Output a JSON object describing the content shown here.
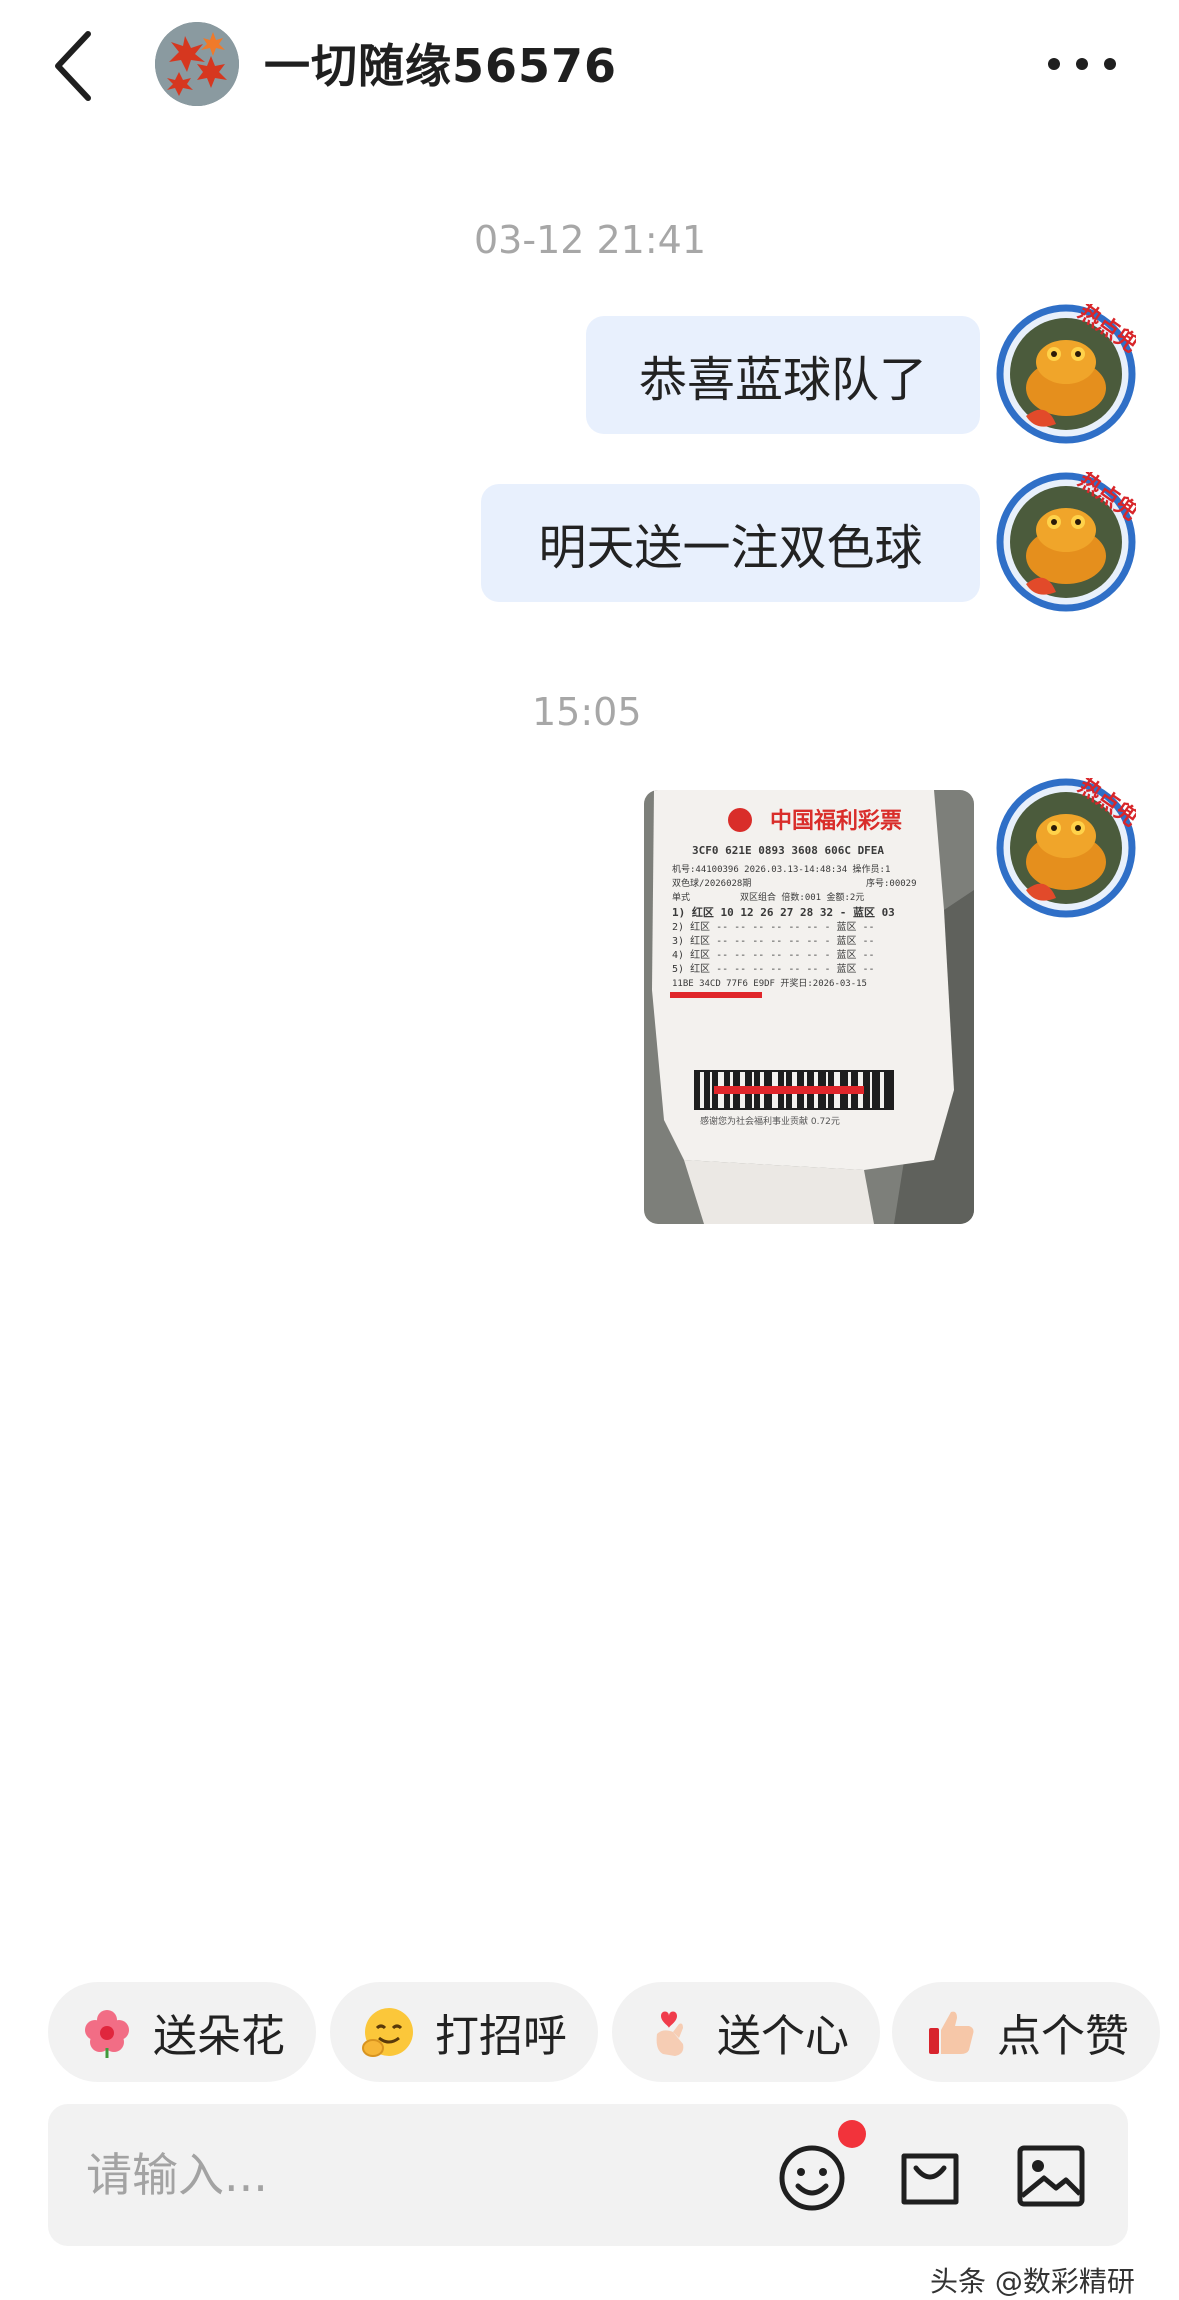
{
  "header": {
    "title": "一切随缘56576",
    "back_icon": "chevron-left-icon",
    "more_icon": "more-horizontal-icon"
  },
  "messages": {
    "timestamp_1": "03-12 21:41",
    "bubble_1": "恭喜蓝球队了",
    "bubble_2": "明天送一注双色球",
    "timestamp_2": "15:05",
    "avatar_badge": "热点兜",
    "ticket": {
      "brand": "中国福利彩票",
      "line_code": "3CF0 621E 0893 3608 606C DFEA",
      "line_machine": "机号:44100396 2026.03.13-14:48:34 操作员:1",
      "line_issue": "双色球/2026028期",
      "line_serial": "序号:00029",
      "line_type": "单式",
      "line_combo": "双区组合 倍数:001 金额:2元",
      "row1": "1) 红区 10 12 26 27 28 32 - 蓝区 03",
      "row_empty": "红区 -- -- -- -- -- -- - 蓝区 --",
      "line_footer": "11BE 34CD 77F6 E9DF 开奖日:2026-03-15",
      "line_thanks": "感谢您为社会福利事业贡献 0.72元"
    }
  },
  "quick_actions": [
    {
      "label": "送朵花",
      "icon": "flower-icon"
    },
    {
      "label": "打招呼",
      "icon": "wave-emoji-icon"
    },
    {
      "label": "送个心",
      "icon": "finger-heart-icon"
    },
    {
      "label": "点个赞",
      "icon": "thumbs-up-icon"
    }
  ],
  "input": {
    "placeholder": "请输入...",
    "value": ""
  },
  "watermark": "头条 @数彩精研",
  "colors": {
    "bubble_bg": "#e8f0fd",
    "chip_bg": "#f2f2f2",
    "badge_red": "#f2333b",
    "avatar_ring": "#2f6fc7"
  }
}
